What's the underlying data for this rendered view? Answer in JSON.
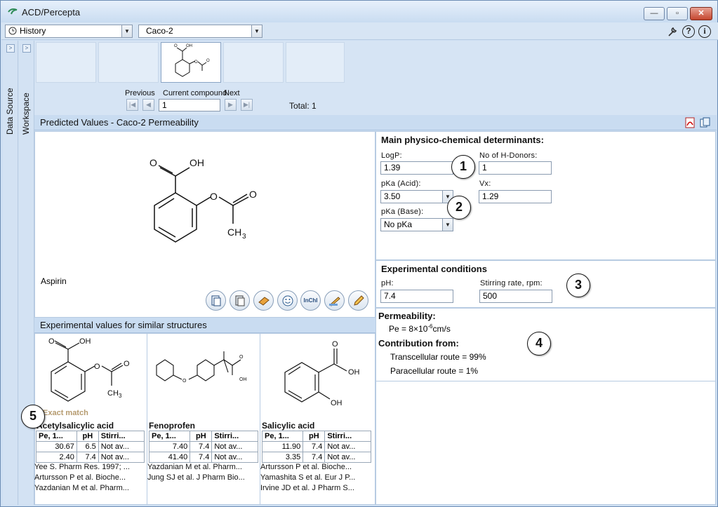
{
  "app": {
    "title": "ACD/Percepta"
  },
  "window_buttons": {
    "minimize": "—",
    "maximize": "▫",
    "close": "✕"
  },
  "toolbar": {
    "history_label": "History",
    "module_value": "Caco-2",
    "help_icon": "?",
    "info_icon": "i"
  },
  "sidebar": {
    "data_source": "Data Source",
    "workspace": "Workspace",
    "expand": ">"
  },
  "navigation": {
    "previous_label": "Previous",
    "current_label": "Current compound",
    "next_label": "Next",
    "current_value": "1",
    "total": "Total: 1"
  },
  "predicted": {
    "title": "Predicted Values - Caco-2 Permeability",
    "compound_name": "Aspirin"
  },
  "determinants": {
    "header": "Main physico-chemical determinants:",
    "logp_label": "LogP:",
    "logp_value": "1.39",
    "hdonors_label": "No of H-Donors:",
    "hdonors_value": "1",
    "pka_acid_label": "pKa (Acid):",
    "pka_acid_value": "3.50",
    "vx_label": "Vx:",
    "vx_value": "1.29",
    "pka_base_label": "pKa (Base):",
    "pka_base_value": "No pKa"
  },
  "conditions": {
    "header": "Experimental conditions",
    "ph_label": "pH:",
    "ph_value": "7.4",
    "stirring_label": "Stirring rate, rpm:",
    "stirring_value": "500"
  },
  "permeability": {
    "header": "Permeability:",
    "pe_prefix": "Pe = 8×10",
    "pe_exp": "-6",
    "pe_unit": "cm/s",
    "contribution_header": "Contribution from:",
    "transcellular": "Transcellular route = 99%",
    "paracellular": "Paracellular route = 1%"
  },
  "callouts": [
    "1",
    "2",
    "3",
    "4",
    "5"
  ],
  "structure_tools": [
    "copy-icon",
    "paste-icon",
    "book-icon",
    "smiley-icon",
    "InChI",
    "edit-icon",
    "pencil-icon"
  ],
  "inchi_label": "InChI",
  "similar": {
    "title": "Experimental values for similar structures",
    "exact_match": "Exact match",
    "compounds": [
      {
        "name": "Acetylsalicylic acid",
        "headers": [
          "Pe, 1...",
          "pH",
          "Stirri..."
        ],
        "rows": [
          [
            "30.67",
            "6.5",
            "Not av..."
          ],
          [
            "2.40",
            "7.4",
            "Not av..."
          ]
        ],
        "refs": [
          "Yee S. Pharm Res. 1997; ...",
          "Artursson P et al. Bioche...",
          "Yazdanian M et al. Pharm..."
        ]
      },
      {
        "name": "Fenoprofen",
        "headers": [
          "Pe, 1...",
          "pH",
          "Stirri..."
        ],
        "rows": [
          [
            "7.40",
            "7.4",
            "Not av..."
          ],
          [
            "41.40",
            "7.4",
            "Not av..."
          ]
        ],
        "refs": [
          "Yazdanian M et al. Pharm...",
          "Jung SJ et al. J Pharm Bio..."
        ]
      },
      {
        "name": "Salicylic acid",
        "headers": [
          "Pe, 1...",
          "pH",
          "Stirri..."
        ],
        "rows": [
          [
            "11.90",
            "7.4",
            "Not av..."
          ],
          [
            "3.35",
            "7.4",
            "Not av..."
          ]
        ],
        "refs": [
          "Artursson P et al. Bioche...",
          "Yamashita S et al. Eur J P...",
          "Irvine JD et al. J Pharm S..."
        ]
      }
    ]
  },
  "atoms": {
    "O": "O",
    "OH": "OH",
    "CH3": "CH",
    "sub3": "3"
  },
  "colors": {
    "accent": "#c9dcf1",
    "panel_border": "#b7cbe2",
    "exact_match": "#b59a6e"
  }
}
